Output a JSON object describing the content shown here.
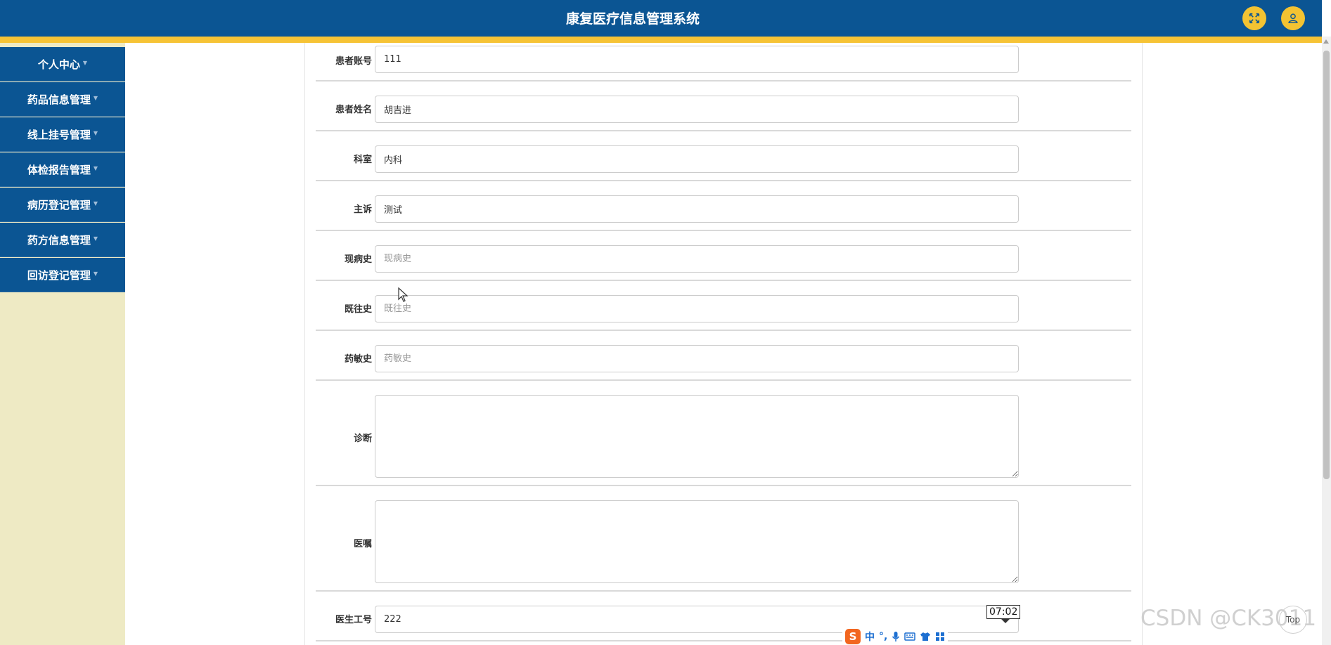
{
  "header": {
    "title": "康复医疗信息管理系统",
    "fullscreen_icon": "fullscreen-icon",
    "user_icon": "user-icon"
  },
  "sidebar": {
    "items": [
      {
        "label": "个人中心"
      },
      {
        "label": "药品信息管理"
      },
      {
        "label": "线上挂号管理"
      },
      {
        "label": "体检报告管理"
      },
      {
        "label": "病历登记管理"
      },
      {
        "label": "药方信息管理"
      },
      {
        "label": "回访登记管理"
      }
    ]
  },
  "form": {
    "patient_account": {
      "label": "患者账号",
      "value": "111"
    },
    "patient_name": {
      "label": "患者姓名",
      "value": "胡吉进"
    },
    "department": {
      "label": "科室",
      "value": "内科"
    },
    "chief_complaint": {
      "label": "主诉",
      "value": "测试"
    },
    "present_history": {
      "label": "现病史",
      "placeholder": "现病史"
    },
    "past_history": {
      "label": "既往史",
      "placeholder": "既往史"
    },
    "allergy_history": {
      "label": "药敏史",
      "placeholder": "药敏史"
    },
    "diagnosis": {
      "label": "诊断"
    },
    "medical_advice": {
      "label": "医嘱"
    },
    "doctor_id": {
      "label": "医生工号",
      "value": "222"
    }
  },
  "overlay": {
    "clock": "07:02",
    "watermark": "CSDN @CK3011",
    "top_link": "Top",
    "ime": {
      "logo": "S",
      "mode": "中",
      "punct": "°,"
    }
  },
  "colors": {
    "header_bg": "#0b5593",
    "stripe": "#f6c335",
    "sidebar_bg": "#eeeac4",
    "menu_bg": "#0b5593",
    "icon_btn": "#f3c332"
  }
}
